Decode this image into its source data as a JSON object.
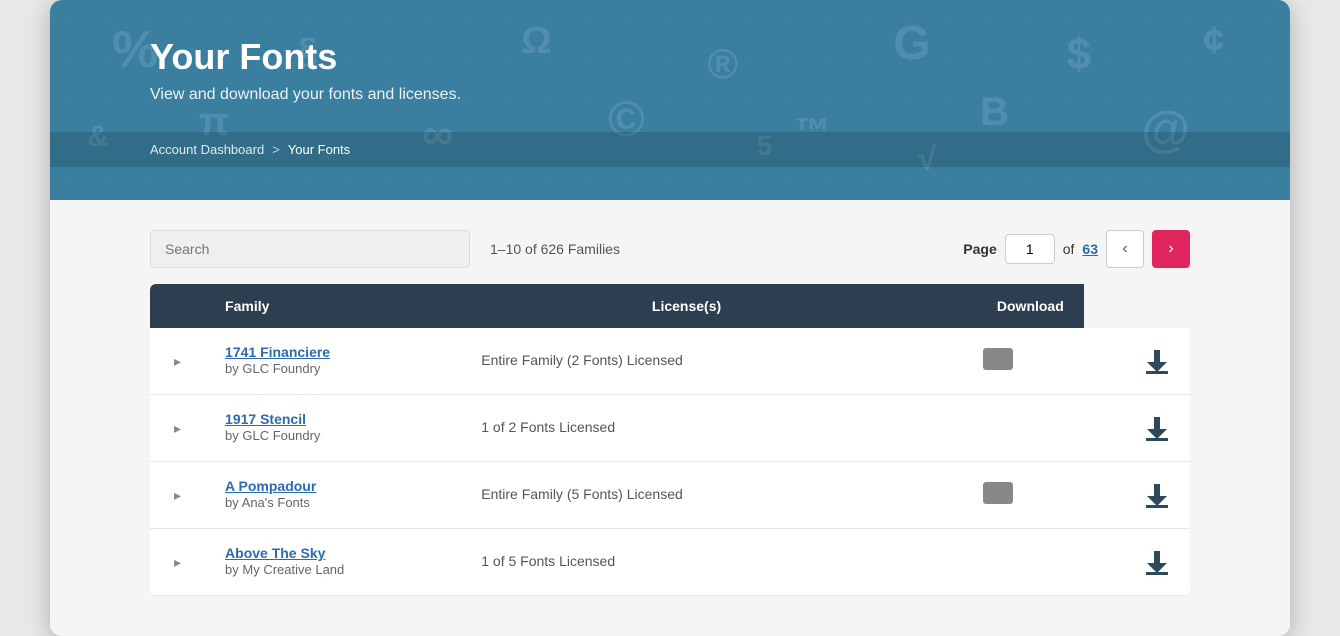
{
  "header": {
    "title": "Your Fonts",
    "subtitle": "View and download your fonts and licenses.",
    "background_color": "#3a7fa0"
  },
  "breadcrumb": {
    "home_label": "Account Dashboard",
    "separator": ">",
    "current": "Your Fonts"
  },
  "toolbar": {
    "search_placeholder": "Search",
    "results_text": "1–10 of 626 Families",
    "page_label": "Page",
    "page_current": "1",
    "page_of": "of",
    "page_total": "63",
    "prev_label": "‹",
    "next_label": "›"
  },
  "table": {
    "headers": {
      "family": "Family",
      "licenses": "License(s)",
      "download": "Download"
    },
    "rows": [
      {
        "name": "1741 Financiere",
        "foundry": "by GLC Foundry",
        "license_text": "Entire Family (2 Fonts) Licensed",
        "has_license_icon": true
      },
      {
        "name": "1917 Stencil",
        "foundry": "by GLC Foundry",
        "license_text": "1 of 2 Fonts Licensed",
        "has_license_icon": false
      },
      {
        "name": "A Pompadour",
        "foundry": "by Ana's Fonts",
        "license_text": "Entire Family (5 Fonts) Licensed",
        "has_license_icon": true
      },
      {
        "name": "Above The Sky",
        "foundry": "by My Creative Land",
        "license_text": "1 of 5 Fonts Licensed",
        "has_license_icon": false
      }
    ]
  }
}
